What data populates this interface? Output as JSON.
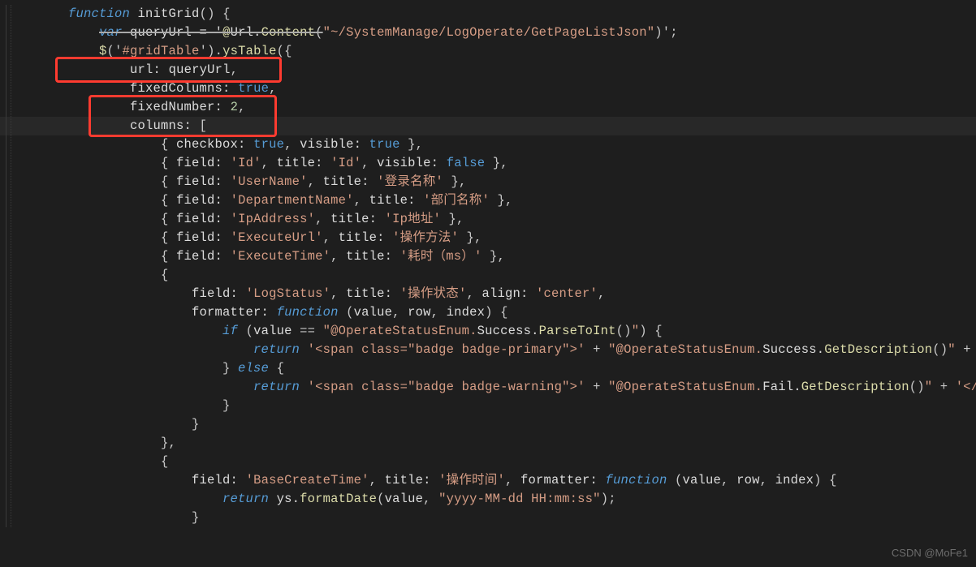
{
  "watermark": "CSDN @MoFe1",
  "code": [
    [
      {
        "cls": "punct",
        "t": "    "
      },
      {
        "cls": "kw-blue",
        "t": "function"
      },
      {
        "cls": "punct",
        "t": " "
      },
      {
        "cls": "ident",
        "t": "initGrid"
      },
      {
        "cls": "punct",
        "t": "() {"
      }
    ],
    [
      {
        "cls": "punct",
        "t": "        "
      },
      {
        "cls": "kw-blue struck",
        "t": "var"
      },
      {
        "cls": "punct struck",
        "t": " "
      },
      {
        "cls": "ident struck",
        "t": "queryUrl = '"
      },
      {
        "cls": "meth struck",
        "t": "@"
      },
      {
        "cls": "ident struck",
        "t": "Url."
      },
      {
        "cls": "meth struck",
        "t": "Content"
      },
      {
        "cls": "punct struck",
        "t": "("
      },
      {
        "cls": "str",
        "t": "\"~/SystemManage/LogOperate/GetPageListJson\""
      },
      {
        "cls": "punct",
        "t": ")';"
      }
    ],
    [
      {
        "cls": "punct",
        "t": "        "
      },
      {
        "cls": "meth",
        "t": "$"
      },
      {
        "cls": "punct",
        "t": "('"
      },
      {
        "cls": "str",
        "t": "#gridTable"
      },
      {
        "cls": "punct",
        "t": "')."
      },
      {
        "cls": "meth",
        "t": "ysTable"
      },
      {
        "cls": "punct",
        "t": "({"
      }
    ],
    [
      {
        "cls": "punct",
        "t": "            "
      },
      {
        "cls": "ident",
        "t": "url:"
      },
      {
        "cls": "punct",
        "t": " "
      },
      {
        "cls": "ident",
        "t": "queryUrl"
      },
      {
        "cls": "punct",
        "t": ","
      }
    ],
    [
      {
        "cls": "punct",
        "t": "            "
      },
      {
        "cls": "ident",
        "t": "fixedColumns:"
      },
      {
        "cls": "punct",
        "t": " "
      },
      {
        "cls": "kw-nitl",
        "t": "true"
      },
      {
        "cls": "punct",
        "t": ","
      }
    ],
    [
      {
        "cls": "punct",
        "t": "            "
      },
      {
        "cls": "ident",
        "t": "fixedNumber:"
      },
      {
        "cls": "punct",
        "t": " "
      },
      {
        "cls": "num",
        "t": "2"
      },
      {
        "cls": "punct",
        "t": ","
      }
    ],
    [
      {
        "cls": "punct",
        "t": "            "
      },
      {
        "cls": "ident",
        "t": "columns:"
      },
      {
        "cls": "punct",
        "t": " ["
      }
    ],
    [
      {
        "cls": "punct",
        "t": "                { "
      },
      {
        "cls": "ident",
        "t": "checkbox:"
      },
      {
        "cls": "punct",
        "t": " "
      },
      {
        "cls": "kw-nitl",
        "t": "true"
      },
      {
        "cls": "punct",
        "t": ", "
      },
      {
        "cls": "ident",
        "t": "visible:"
      },
      {
        "cls": "punct",
        "t": " "
      },
      {
        "cls": "kw-nitl",
        "t": "true"
      },
      {
        "cls": "punct",
        "t": " },"
      }
    ],
    [
      {
        "cls": "punct",
        "t": "                { "
      },
      {
        "cls": "ident",
        "t": "field:"
      },
      {
        "cls": "punct",
        "t": " "
      },
      {
        "cls": "str",
        "t": "'Id'"
      },
      {
        "cls": "punct",
        "t": ", "
      },
      {
        "cls": "ident",
        "t": "title:"
      },
      {
        "cls": "punct",
        "t": " "
      },
      {
        "cls": "str",
        "t": "'Id'"
      },
      {
        "cls": "punct",
        "t": ", "
      },
      {
        "cls": "ident",
        "t": "visible:"
      },
      {
        "cls": "punct",
        "t": " "
      },
      {
        "cls": "kw-nitl",
        "t": "false"
      },
      {
        "cls": "punct",
        "t": " },"
      }
    ],
    [
      {
        "cls": "punct",
        "t": "                { "
      },
      {
        "cls": "ident",
        "t": "field:"
      },
      {
        "cls": "punct",
        "t": " "
      },
      {
        "cls": "str",
        "t": "'UserName'"
      },
      {
        "cls": "punct",
        "t": ", "
      },
      {
        "cls": "ident",
        "t": "title:"
      },
      {
        "cls": "punct",
        "t": " "
      },
      {
        "cls": "str",
        "t": "'登录名称'"
      },
      {
        "cls": "punct",
        "t": " },"
      }
    ],
    [
      {
        "cls": "punct",
        "t": "                { "
      },
      {
        "cls": "ident",
        "t": "field:"
      },
      {
        "cls": "punct",
        "t": " "
      },
      {
        "cls": "str",
        "t": "'DepartmentName'"
      },
      {
        "cls": "punct",
        "t": ", "
      },
      {
        "cls": "ident",
        "t": "title:"
      },
      {
        "cls": "punct",
        "t": " "
      },
      {
        "cls": "str",
        "t": "'部门名称'"
      },
      {
        "cls": "punct",
        "t": " },"
      }
    ],
    [
      {
        "cls": "punct",
        "t": "                { "
      },
      {
        "cls": "ident",
        "t": "field:"
      },
      {
        "cls": "punct",
        "t": " "
      },
      {
        "cls": "str",
        "t": "'IpAddress'"
      },
      {
        "cls": "punct",
        "t": ", "
      },
      {
        "cls": "ident",
        "t": "title:"
      },
      {
        "cls": "punct",
        "t": " "
      },
      {
        "cls": "str",
        "t": "'Ip地址'"
      },
      {
        "cls": "punct",
        "t": " },"
      }
    ],
    [
      {
        "cls": "punct",
        "t": "                { "
      },
      {
        "cls": "ident",
        "t": "field:"
      },
      {
        "cls": "punct",
        "t": " "
      },
      {
        "cls": "str",
        "t": "'ExecuteUrl'"
      },
      {
        "cls": "punct",
        "t": ", "
      },
      {
        "cls": "ident",
        "t": "title:"
      },
      {
        "cls": "punct",
        "t": " "
      },
      {
        "cls": "str",
        "t": "'操作方法'"
      },
      {
        "cls": "punct",
        "t": " },"
      }
    ],
    [
      {
        "cls": "punct",
        "t": "                { "
      },
      {
        "cls": "ident",
        "t": "field:"
      },
      {
        "cls": "punct",
        "t": " "
      },
      {
        "cls": "str",
        "t": "'ExecuteTime'"
      },
      {
        "cls": "punct",
        "t": ", "
      },
      {
        "cls": "ident",
        "t": "title:"
      },
      {
        "cls": "punct",
        "t": " "
      },
      {
        "cls": "str",
        "t": "'耗时（ms）'"
      },
      {
        "cls": "punct",
        "t": " },"
      }
    ],
    [
      {
        "cls": "punct",
        "t": "                {"
      }
    ],
    [
      {
        "cls": "punct",
        "t": "                    "
      },
      {
        "cls": "ident",
        "t": "field:"
      },
      {
        "cls": "punct",
        "t": " "
      },
      {
        "cls": "str",
        "t": "'LogStatus'"
      },
      {
        "cls": "punct",
        "t": ", "
      },
      {
        "cls": "ident",
        "t": "title:"
      },
      {
        "cls": "punct",
        "t": " "
      },
      {
        "cls": "str",
        "t": "'操作状态'"
      },
      {
        "cls": "punct",
        "t": ", "
      },
      {
        "cls": "ident",
        "t": "align:"
      },
      {
        "cls": "punct",
        "t": " "
      },
      {
        "cls": "str",
        "t": "'center'"
      },
      {
        "cls": "punct",
        "t": ","
      }
    ],
    [
      {
        "cls": "punct",
        "t": "                    "
      },
      {
        "cls": "ident",
        "t": "formatter:"
      },
      {
        "cls": "punct",
        "t": " "
      },
      {
        "cls": "kw-blue",
        "t": "function"
      },
      {
        "cls": "punct",
        "t": " ("
      },
      {
        "cls": "ident",
        "t": "value"
      },
      {
        "cls": "punct",
        "t": ", "
      },
      {
        "cls": "ident",
        "t": "row"
      },
      {
        "cls": "punct",
        "t": ", "
      },
      {
        "cls": "ident",
        "t": "index"
      },
      {
        "cls": "punct",
        "t": ") {"
      }
    ],
    [
      {
        "cls": "punct",
        "t": "                        "
      },
      {
        "cls": "kw-blue",
        "t": "if"
      },
      {
        "cls": "punct",
        "t": " ("
      },
      {
        "cls": "ident",
        "t": "value"
      },
      {
        "cls": "punct",
        "t": " == "
      },
      {
        "cls": "str",
        "t": "\"@OperateStatusEnum."
      },
      {
        "cls": "ident",
        "t": "Success."
      },
      {
        "cls": "meth",
        "t": "ParseToInt"
      },
      {
        "cls": "punct",
        "t": "()"
      },
      {
        "cls": "str",
        "t": "\""
      },
      {
        "cls": "punct",
        "t": ") {"
      }
    ],
    [
      {
        "cls": "punct",
        "t": "                            "
      },
      {
        "cls": "kw-blue",
        "t": "return"
      },
      {
        "cls": "punct",
        "t": " "
      },
      {
        "cls": "str",
        "t": "'<span class=\"badge badge-primary\">'"
      },
      {
        "cls": "punct",
        "t": " + "
      },
      {
        "cls": "str",
        "t": "\"@OperateStatusEnum."
      },
      {
        "cls": "ident",
        "t": "Success."
      },
      {
        "cls": "meth",
        "t": "GetDescription"
      },
      {
        "cls": "punct",
        "t": "()"
      },
      {
        "cls": "str",
        "t": "\""
      },
      {
        "cls": "punct",
        "t": " + '"
      }
    ],
    [
      {
        "cls": "punct",
        "t": "                        } "
      },
      {
        "cls": "kw-blue",
        "t": "else"
      },
      {
        "cls": "punct",
        "t": " {"
      }
    ],
    [
      {
        "cls": "punct",
        "t": "                            "
      },
      {
        "cls": "kw-blue",
        "t": "return"
      },
      {
        "cls": "punct",
        "t": " "
      },
      {
        "cls": "str",
        "t": "'<span class=\"badge badge-warning\">'"
      },
      {
        "cls": "punct",
        "t": " + "
      },
      {
        "cls": "str",
        "t": "\"@OperateStatusEnum."
      },
      {
        "cls": "ident",
        "t": "Fail."
      },
      {
        "cls": "meth",
        "t": "GetDescription"
      },
      {
        "cls": "punct",
        "t": "()"
      },
      {
        "cls": "str",
        "t": "\""
      },
      {
        "cls": "punct",
        "t": " + "
      },
      {
        "cls": "str",
        "t": "'</"
      }
    ],
    [
      {
        "cls": "punct",
        "t": "                        }"
      }
    ],
    [
      {
        "cls": "punct",
        "t": "                    }"
      }
    ],
    [
      {
        "cls": "punct",
        "t": "                },"
      }
    ],
    [
      {
        "cls": "punct",
        "t": "                {"
      }
    ],
    [
      {
        "cls": "punct",
        "t": "                    "
      },
      {
        "cls": "ident",
        "t": "field:"
      },
      {
        "cls": "punct",
        "t": " "
      },
      {
        "cls": "str",
        "t": "'BaseCreateTime'"
      },
      {
        "cls": "punct",
        "t": ", "
      },
      {
        "cls": "ident",
        "t": "title:"
      },
      {
        "cls": "punct",
        "t": " "
      },
      {
        "cls": "str",
        "t": "'操作时间'"
      },
      {
        "cls": "punct",
        "t": ", "
      },
      {
        "cls": "ident",
        "t": "formatter:"
      },
      {
        "cls": "punct",
        "t": " "
      },
      {
        "cls": "kw-blue",
        "t": "function"
      },
      {
        "cls": "punct",
        "t": " ("
      },
      {
        "cls": "ident",
        "t": "value"
      },
      {
        "cls": "punct",
        "t": ", "
      },
      {
        "cls": "ident",
        "t": "row"
      },
      {
        "cls": "punct",
        "t": ", "
      },
      {
        "cls": "ident",
        "t": "index"
      },
      {
        "cls": "punct",
        "t": ") {"
      }
    ],
    [
      {
        "cls": "punct",
        "t": "                        "
      },
      {
        "cls": "kw-blue",
        "t": "return"
      },
      {
        "cls": "punct",
        "t": " "
      },
      {
        "cls": "ident",
        "t": "ys."
      },
      {
        "cls": "meth",
        "t": "formatDate"
      },
      {
        "cls": "punct",
        "t": "("
      },
      {
        "cls": "ident",
        "t": "value"
      },
      {
        "cls": "punct",
        "t": ", "
      },
      {
        "cls": "str",
        "t": "\"yyyy-MM-dd HH:mm:ss\""
      },
      {
        "cls": "punct",
        "t": ");"
      }
    ],
    [
      {
        "cls": "punct",
        "t": "                    }"
      }
    ]
  ]
}
